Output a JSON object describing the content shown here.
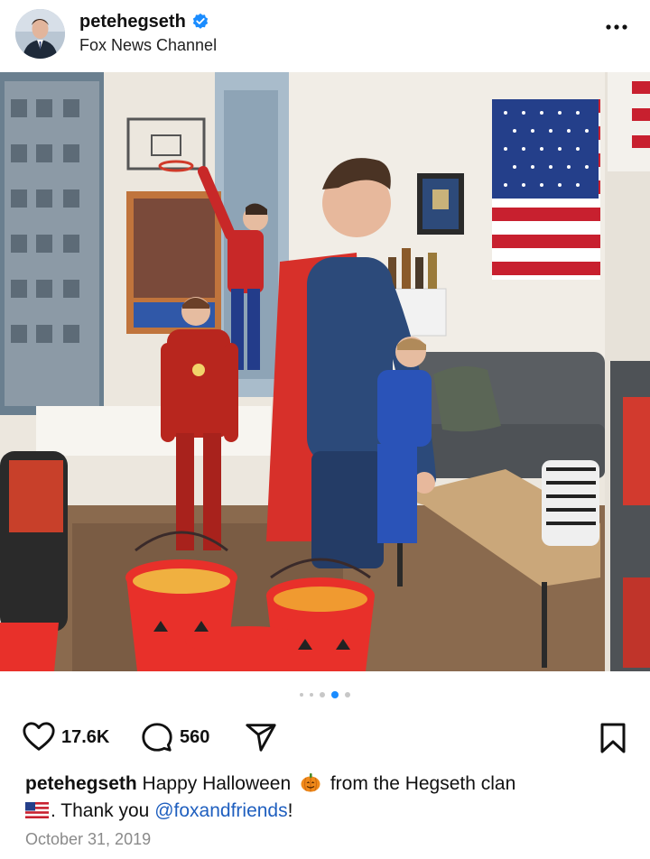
{
  "header": {
    "username": "petehegseth",
    "subtitle": "Fox News Channel",
    "verified": true
  },
  "carousel": {
    "total_dots": 5,
    "active_index": 3
  },
  "actions": {
    "likes": "17.6K",
    "comments": "560"
  },
  "caption": {
    "username": "petehegseth",
    "text_part1": "Happy Halloween",
    "text_part2": "from the Hegseth clan",
    "text_part3": ". Thank you",
    "mention": "@foxandfriends",
    "text_part4": "!",
    "emoji_1": "pumpkin-emoji",
    "emoji_2": "us-flag-emoji"
  },
  "date": "October 31, 2019",
  "colors": {
    "link": "#1f5fbf",
    "verified": "#1a8cff",
    "active_dot": "#1a8cff"
  }
}
